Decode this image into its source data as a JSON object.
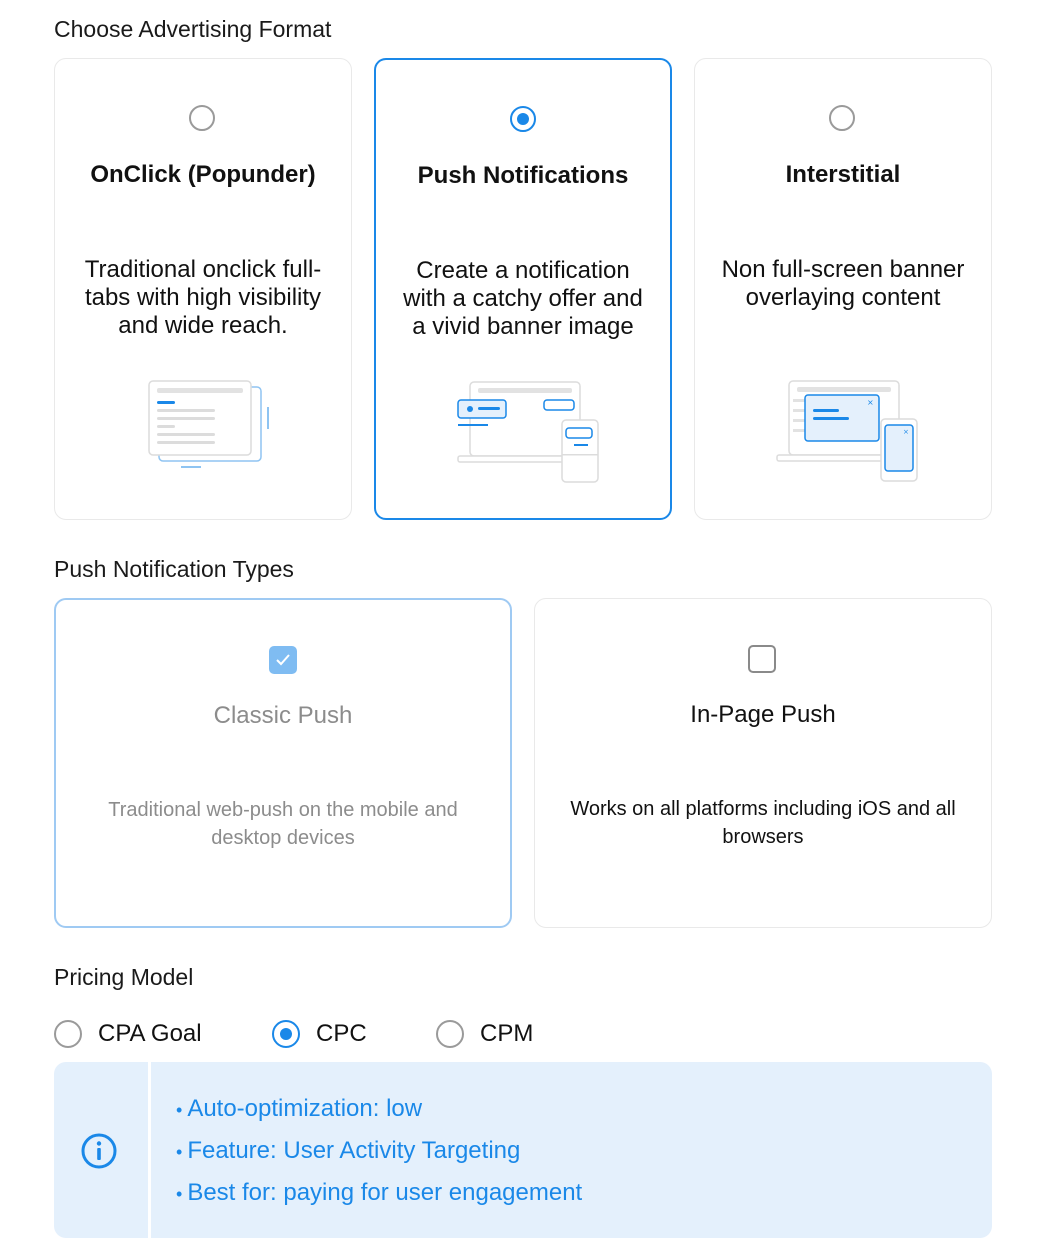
{
  "format_section": {
    "title": "Choose Advertising Format",
    "options": [
      {
        "title": "OnClick (Popunder)",
        "desc_lines": [
          "Traditional onclick full-",
          "tabs with high visibility",
          "and wide reach."
        ],
        "selected": false
      },
      {
        "title": "Push Notifications",
        "desc_lines": [
          "Create a notification",
          "with a catchy offer and",
          "a vivid banner image"
        ],
        "selected": true
      },
      {
        "title": "Interstitial",
        "desc_lines": [
          "Non full-screen banner",
          "overlaying content"
        ],
        "selected": false
      }
    ]
  },
  "push_types_section": {
    "title": "Push Notification Types",
    "options": [
      {
        "title": "Classic Push",
        "desc_lines": [
          "Traditional web-push on the mobile and",
          "desktop devices"
        ],
        "checked": true,
        "disabled": true
      },
      {
        "title": "In-Page Push",
        "desc_lines": [
          "Works on all platforms including iOS and all",
          "browsers"
        ],
        "checked": false,
        "disabled": false
      }
    ]
  },
  "pricing_section": {
    "title": "Pricing Model",
    "options": [
      {
        "label": "CPA Goal",
        "selected": false
      },
      {
        "label": "CPC",
        "selected": true
      },
      {
        "label": "CPM",
        "selected": false
      }
    ]
  },
  "info": {
    "icon": "info-icon",
    "items": [
      "Auto-optimization: low",
      "Feature: User Activity Targeting",
      "Best for: paying for user engagement"
    ]
  },
  "colors": {
    "accent": "#1a88e8",
    "info_bg": "#e4f0fc",
    "border": "#e9e9e9"
  }
}
